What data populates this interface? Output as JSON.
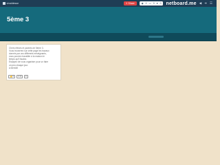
{
  "topbar": {
    "user_label": "vivaldiesse",
    "share_label": "Share",
    "stats": [
      "0",
      "0",
      "0"
    ],
    "brand": "netboard.me",
    "icons": [
      "eye-icon",
      "bell-icon",
      "list-icon",
      "sound-icon",
      "login-icon",
      "menu-icon"
    ]
  },
  "header": {
    "title": "5ème 3"
  },
  "card": {
    "text": "Chers élèves et parents de 5ème 3.\nVous trouverez sur cette page les travaux\ndonnés par vos différents enseignants,\nvous pourrez travailler à la maison le\ntemps qu'il faudra.\nEssayez de vous organiser pour un faire\nun peu chaque jour.\nà bientôt!",
    "counts": [
      "0",
      "0"
    ]
  },
  "colors": {
    "topbar": "#1f3d55",
    "header": "#156a7c",
    "ruler": "#0f4a5a",
    "background": "#f0e2c9",
    "share": "#e04444"
  }
}
